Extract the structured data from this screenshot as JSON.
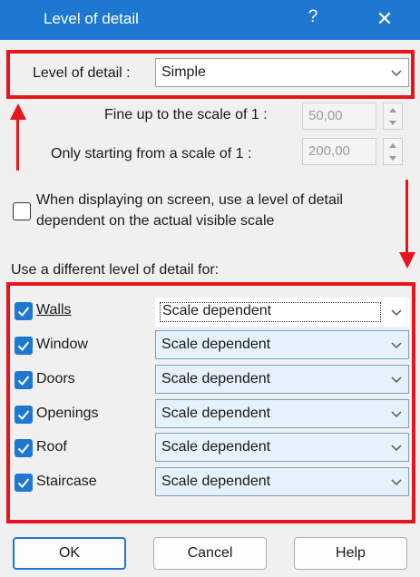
{
  "window": {
    "title": "Level of detail",
    "help_glyph": "?",
    "close_glyph": "✕"
  },
  "main": {
    "level_label": "Level of detail :",
    "level_value": "Simple",
    "fine_label": "Fine up to the scale of 1 :",
    "fine_value": "50,00",
    "only_label": "Only starting from a scale of 1  :",
    "only_value": "200,00",
    "dependent_label_line1": "When displaying on screen, use a level of detail",
    "dependent_label_line2": "dependent on the actual visible scale",
    "dependent_checked": false,
    "different_label": "Use a different level of detail for:"
  },
  "items": [
    {
      "label": "Walls",
      "value": "Scale dependent",
      "checked": true
    },
    {
      "label": "Window",
      "value": "Scale dependent",
      "checked": true
    },
    {
      "label": "Doors",
      "value": "Scale dependent",
      "checked": true
    },
    {
      "label": "Openings",
      "value": "Scale dependent",
      "checked": true
    },
    {
      "label": "Roof",
      "value": "Scale dependent",
      "checked": true
    },
    {
      "label": "Staircase",
      "value": "Scale dependent",
      "checked": true
    }
  ],
  "buttons": {
    "ok": "OK",
    "cancel": "Cancel",
    "help": "Help"
  },
  "colors": {
    "titlebar": "#1e78d2",
    "annotation": "#e8141b",
    "check": "#1e78d2"
  }
}
